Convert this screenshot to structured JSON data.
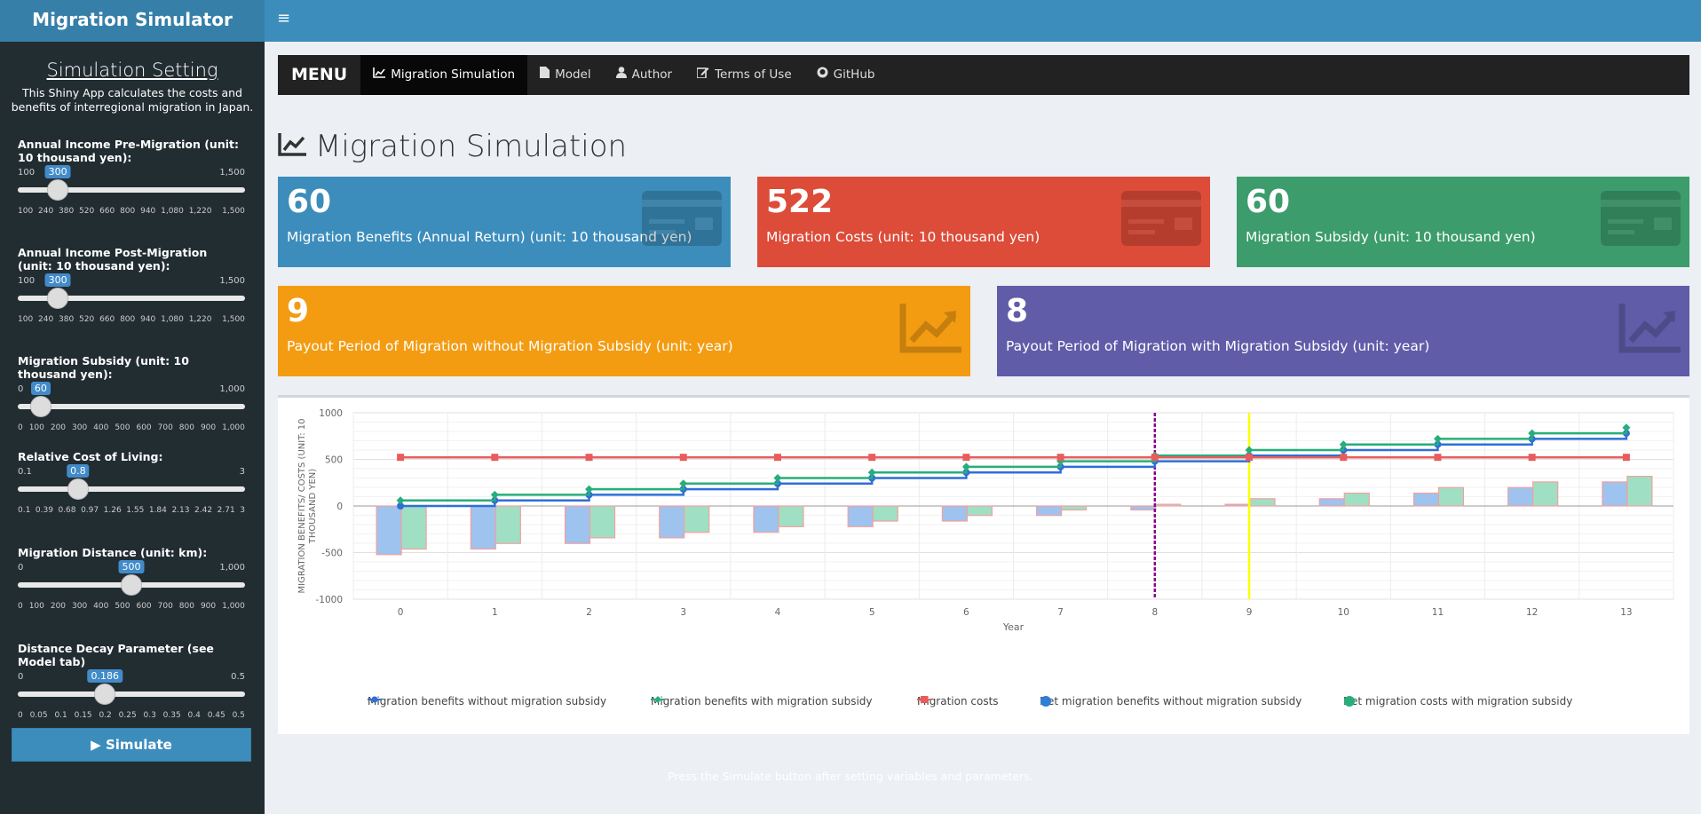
{
  "app": {
    "title": "Migration Simulator"
  },
  "sidebar": {
    "title": "Simulation Setting",
    "description": "This Shiny App calculates the costs and benefits of interregional migration in Japan.",
    "sliders": [
      {
        "label": "Annual Income Pre-Migration (unit: 10 thousand yen):",
        "min": "100",
        "max": "1,500",
        "value": "300",
        "fraction": 0.143,
        "ticks": [
          "100",
          "240",
          "380",
          "520",
          "660",
          "800",
          "940",
          "1,080",
          "1,220",
          "",
          "1,500"
        ]
      },
      {
        "label": "Annual Income Post-Migration (unit: 10 thousand yen):",
        "min": "100",
        "max": "1,500",
        "value": "300",
        "fraction": 0.143,
        "ticks": [
          "100",
          "240",
          "380",
          "520",
          "660",
          "800",
          "940",
          "1,080",
          "1,220",
          "",
          "1,500"
        ]
      },
      {
        "label": "Migration Subsidy (unit: 10 thousand yen):",
        "min": "0",
        "max": "1,000",
        "value": "60",
        "fraction": 0.06,
        "ticks": [
          "0",
          "100",
          "200",
          "300",
          "400",
          "500",
          "600",
          "700",
          "800",
          "900",
          "1,000"
        ]
      },
      {
        "label": "Relative Cost of Living:",
        "min": "0.1",
        "max": "3",
        "value": "0.8",
        "fraction": 0.241,
        "ticks": [
          "0.1",
          "0.39",
          "0.68",
          "0.97",
          "1.26",
          "1.55",
          "1.84",
          "2.13",
          "2.42",
          "2.71",
          "3"
        ]
      },
      {
        "label": "Migration Distance (unit: km):",
        "min": "0",
        "max": "1,000",
        "value": "500",
        "fraction": 0.5,
        "ticks": [
          "0",
          "100",
          "200",
          "300",
          "400",
          "500",
          "600",
          "700",
          "800",
          "900",
          "1,000"
        ]
      },
      {
        "label": "Distance Decay Parameter (see Model tab)",
        "min": "0",
        "max": "0.5",
        "value": "0.186",
        "fraction": 0.372,
        "ticks": [
          "0",
          "0.05",
          "0.1",
          "0.15",
          "0.2",
          "0.25",
          "0.3",
          "0.35",
          "0.4",
          "0.45",
          "0.5"
        ]
      }
    ],
    "simulate_label": "Simulate",
    "footer": "Press the Simulate button after setting variables and parameters."
  },
  "navbar": {
    "brand": "MENU",
    "items": [
      {
        "label": "Migration Simulation",
        "icon": "line-chart-icon",
        "active": true
      },
      {
        "label": "Model",
        "icon": "file-icon",
        "active": false
      },
      {
        "label": "Author",
        "icon": "user-icon",
        "active": false
      },
      {
        "label": "Terms of Use",
        "icon": "edit-icon",
        "active": false
      },
      {
        "label": "GitHub",
        "icon": "github-icon",
        "active": false
      }
    ]
  },
  "page": {
    "title": "Migration Simulation"
  },
  "value_boxes": [
    {
      "value": "60",
      "subtitle": "Migration Benefits (Annual Return) (unit: 10 thousand yen)",
      "color": "#3c8dbc",
      "icon": "credit-card-icon"
    },
    {
      "value": "522",
      "subtitle": "Migration Costs (unit: 10 thousand yen)",
      "color": "#dd4b39",
      "icon": "credit-card-icon"
    },
    {
      "value": "60",
      "subtitle": "Migration Subsidy (unit: 10 thousand yen)",
      "color": "#3c9c6c",
      "icon": "credit-card-icon"
    },
    {
      "value": "9",
      "subtitle": "Payout Period of Migration without Migration Subsidy (unit: year)",
      "color": "#f39c12",
      "icon": "area-chart-icon"
    },
    {
      "value": "8",
      "subtitle": "Payout Period of Migration with Migration Subsidy (unit: year)",
      "color": "#605ca8",
      "icon": "area-chart-icon"
    }
  ],
  "chart_data": {
    "type": "line",
    "title": "",
    "xlabel": "Year",
    "ylabel": "MIGRATION BENEFITS/ COSTS (UNIT: 10 THOUSAND YEN)",
    "x": [
      0,
      1,
      2,
      3,
      4,
      5,
      6,
      7,
      8,
      9,
      10,
      11,
      12,
      13
    ],
    "ylim": [
      -1000,
      1000
    ],
    "yticks": [
      "1000",
      "500",
      "0",
      "-500",
      "-1000"
    ],
    "vlines": [
      {
        "x": 8,
        "color": "#8b008b",
        "style": "dashed"
      },
      {
        "x": 9,
        "color": "#ffff00",
        "style": "solid"
      }
    ],
    "series": [
      {
        "name": "Migration benefits without migration subsidy",
        "kind": "step",
        "color": "#2f6fd6",
        "values": [
          0,
          60,
          120,
          180,
          240,
          300,
          360,
          420,
          480,
          540,
          600,
          660,
          720,
          780
        ]
      },
      {
        "name": "Migration benefits with migration subsidy",
        "kind": "step",
        "color": "#27ae7a",
        "values": [
          60,
          120,
          180,
          240,
          300,
          360,
          420,
          480,
          540,
          600,
          660,
          720,
          780,
          840
        ]
      },
      {
        "name": "Migration costs",
        "kind": "line",
        "color": "#e85c5c",
        "values": [
          522,
          522,
          522,
          522,
          522,
          522,
          522,
          522,
          522,
          522,
          522,
          522,
          522,
          522
        ]
      },
      {
        "name": "Net migration benefits without migration subsidy",
        "kind": "bar",
        "color": "#9ec3ee",
        "values": [
          -522,
          -462,
          -402,
          -342,
          -282,
          -222,
          -162,
          -102,
          -42,
          18,
          78,
          138,
          198,
          258
        ]
      },
      {
        "name": "Net migration costs with migration subsidy",
        "kind": "bar",
        "color": "#9fe0c4",
        "values": [
          -462,
          -402,
          -342,
          -282,
          -222,
          -162,
          -102,
          -42,
          18,
          78,
          138,
          198,
          258,
          318
        ]
      }
    ]
  }
}
